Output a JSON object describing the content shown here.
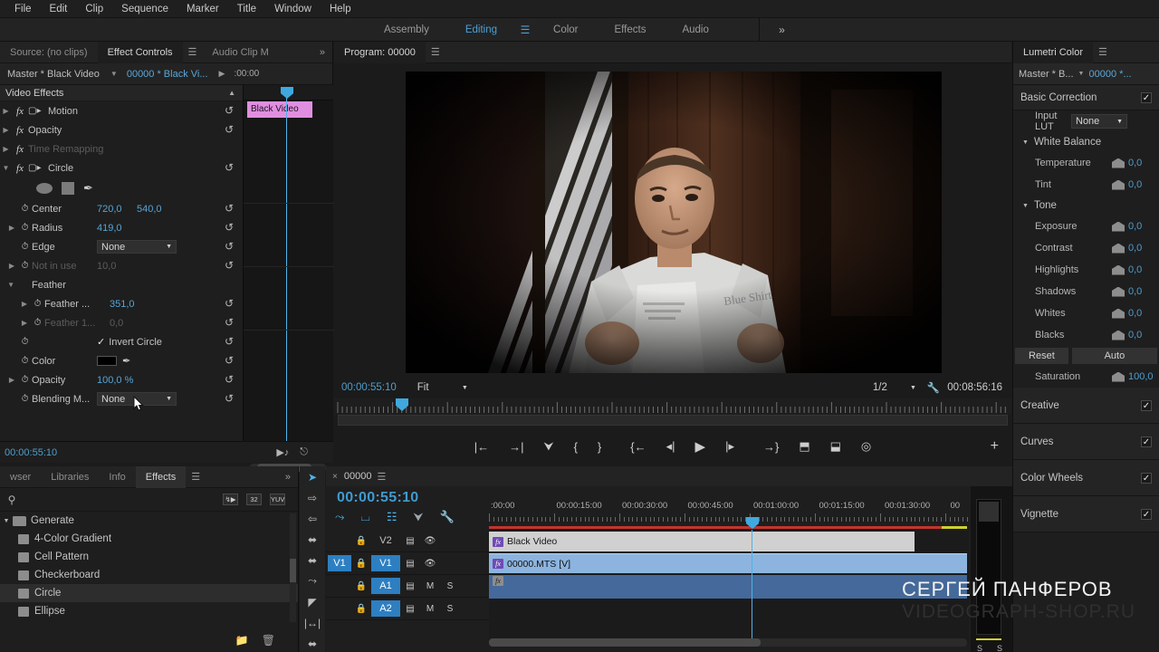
{
  "menu": {
    "items": [
      "File",
      "Edit",
      "Clip",
      "Sequence",
      "Marker",
      "Title",
      "Window",
      "Help"
    ]
  },
  "workspace": {
    "tabs": [
      "Assembly",
      "Editing",
      "Color",
      "Effects",
      "Audio"
    ],
    "active": "Editing",
    "menu_icon": "☰",
    "overflow_icon": "»"
  },
  "effect_controls": {
    "tabs": [
      {
        "label": "Source: (no clips)",
        "active": false
      },
      {
        "label": "Effect Controls",
        "active": true
      },
      {
        "label": "Audio Clip M",
        "active": false
      }
    ],
    "tab_menu_icon": "☰",
    "overflow_icon": "»",
    "master_label": "Master * Black Video",
    "dropdown_icon": "▼",
    "clip_label": "00000 * Black Vi...",
    "play_icon": "▶",
    "timeline_start": ":00:00",
    "timeline_clip_label": "Black Video",
    "section_title": "Video Effects",
    "collapse_icon": "▲",
    "reset_icon": "↺",
    "effects": [
      {
        "name": "Motion",
        "twirl": "▶",
        "fx": "fx",
        "has_transform": true,
        "dim": false
      },
      {
        "name": "Opacity",
        "twirl": "▶",
        "fx": "fx",
        "has_transform": false,
        "dim": false
      },
      {
        "name": "Time Remapping",
        "twirl": "▶",
        "fx": "fx",
        "has_transform": false,
        "dim": true
      },
      {
        "name": "Circle",
        "twirl": "▼",
        "fx": "fx",
        "has_transform": true,
        "dim": false
      }
    ],
    "circle_params": {
      "shape_tools": [
        "ellipse-mask",
        "rectangle-mask",
        "pen-mask"
      ],
      "rows": [
        {
          "name": "Center",
          "value": "720,0",
          "value2": "540,0",
          "type": "two",
          "twirl": "",
          "dim": false
        },
        {
          "name": "Radius",
          "value": "419,0",
          "type": "one",
          "twirl": "▶",
          "dim": false
        },
        {
          "name": "Edge",
          "value": "None",
          "type": "dropdown",
          "twirl": "",
          "dim": false
        },
        {
          "name": "Not in use",
          "value": "10,0",
          "type": "one",
          "twirl": "▶",
          "dim": true
        },
        {
          "name": "Feather",
          "value": "",
          "type": "group",
          "twirl": "▼",
          "dim": false
        },
        {
          "name": "Feather ...",
          "value": "351,0",
          "type": "one",
          "twirl": "▶",
          "dim": false,
          "indent": true
        },
        {
          "name": "Feather 1...",
          "value": "0,0",
          "type": "one",
          "twirl": "▶",
          "dim": true,
          "indent": true
        },
        {
          "name": "",
          "value": "Invert Circle",
          "type": "checkbox",
          "twirl": "",
          "dim": false
        },
        {
          "name": "Color",
          "value": "#000000",
          "type": "color",
          "twirl": "",
          "dim": false
        },
        {
          "name": "Opacity",
          "value": "100,0 %",
          "type": "one",
          "twirl": "▶",
          "dim": false
        },
        {
          "name": "Blending M...",
          "value": "None",
          "type": "dropdown",
          "twirl": "",
          "dim": false
        }
      ]
    },
    "status_timecode": "00:00:55:10",
    "status_icons": [
      "play-audio-icon",
      "export-frame-icon"
    ]
  },
  "program_monitor": {
    "tab_label": "Program: 00000",
    "tab_menu_icon": "☰",
    "timecode": "00:00:55:10",
    "fit_label": "Fit",
    "resolution_label": "1/2",
    "wrench_icon": "⚒",
    "duration": "00:08:56:16",
    "buttons": [
      "mark-in",
      "mark-out",
      "add-marker",
      "go-to-in",
      "go-to-out",
      "step-back-unit",
      "step-back",
      "play-pause",
      "step-forward",
      "step-forward-unit",
      "lift",
      "extract",
      "export-frame"
    ],
    "button_glyphs": [
      "|←",
      "→|",
      "⮟",
      "{",
      "}",
      "{←",
      "◂|",
      "▶",
      "|▸",
      "→}",
      "⬒",
      "⬓",
      "◎"
    ],
    "plus_icon": "+"
  },
  "lumetri": {
    "tab_label": "Lumetri Color",
    "tab_menu_icon": "☰",
    "master_label": "Master * B...",
    "dropdown_icon": "▼",
    "clip_label": "00000 *...",
    "check_icon": "✓",
    "sections": [
      {
        "label": "Basic Correction",
        "checked": true
      },
      {
        "label": "Creative",
        "checked": true
      },
      {
        "label": "Curves",
        "checked": true
      },
      {
        "label": "Color Wheels",
        "checked": true
      },
      {
        "label": "Vignette",
        "checked": true
      }
    ],
    "input_lut_label": "Input LUT",
    "input_lut_value": "None",
    "white_balance_label": "White Balance",
    "tone_label": "Tone",
    "group_twirl": "▼",
    "sliders": [
      {
        "label": "Temperature",
        "value": "0,0"
      },
      {
        "label": "Tint",
        "value": "0,0"
      },
      {
        "label": "Exposure",
        "value": "0,0"
      },
      {
        "label": "Contrast",
        "value": "0,0"
      },
      {
        "label": "Highlights",
        "value": "0,0"
      },
      {
        "label": "Shadows",
        "value": "0,0"
      },
      {
        "label": "Whites",
        "value": "0,0"
      },
      {
        "label": "Blacks",
        "value": "0,0"
      }
    ],
    "reset_label": "Reset",
    "auto_label": "Auto",
    "saturation_label": "Saturation",
    "saturation_value": "100,0"
  },
  "effects_browser": {
    "tabs": [
      {
        "label": "wser",
        "active": false
      },
      {
        "label": "Libraries",
        "active": false
      },
      {
        "label": "Info",
        "active": false
      },
      {
        "label": "Effects",
        "active": true
      }
    ],
    "tab_menu_icon": "☰",
    "overflow_icon": "»",
    "search_placeholder": "",
    "search_value": "",
    "filter_icons": [
      "accelerated-effects-icon",
      "32-bit-color-icon",
      "yuv-icon"
    ],
    "filter_labels": [
      "↯▶",
      "32",
      "YUV"
    ],
    "folder": {
      "label": "Generate",
      "twirl": "▼"
    },
    "items": [
      {
        "label": "4-Color Gradient",
        "selected": false
      },
      {
        "label": "Cell Pattern",
        "selected": false
      },
      {
        "label": "Checkerboard",
        "selected": false
      },
      {
        "label": "Circle",
        "selected": true
      },
      {
        "label": "Ellipse",
        "selected": false
      }
    ],
    "footer_icons": [
      "new-folder-icon",
      "delete-icon"
    ]
  },
  "tools": {
    "items": [
      {
        "name": "selection-tool",
        "glyph": "➤",
        "active": true
      },
      {
        "name": "track-select-fwd-tool",
        "glyph": "⇨",
        "active": false
      },
      {
        "name": "track-select-back-tool",
        "glyph": "⇦",
        "active": false
      },
      {
        "name": "ripple-edit-tool",
        "glyph": "⬌",
        "active": false
      },
      {
        "name": "rolling-edit-tool",
        "glyph": "⬌",
        "active": false
      },
      {
        "name": "rate-stretch-tool",
        "glyph": "⤳",
        "active": false
      },
      {
        "name": "razor-tool",
        "glyph": "◤",
        "active": false
      },
      {
        "name": "slip-tool",
        "glyph": "|↔|",
        "active": false
      },
      {
        "name": "slide-tool",
        "glyph": "⬌",
        "active": false
      }
    ]
  },
  "timeline": {
    "tab_label": "00000",
    "close_icon": "×",
    "tab_menu_icon": "☰",
    "timecode": "00:00:55:10",
    "toolbar_icons": [
      "snap-icon",
      "linked-selection-icon",
      "markers-visible-icon",
      "add-marker-icon",
      "timeline-settings-icon"
    ],
    "ruler_labels": [
      ":00:00",
      "00:00:15:00",
      "00:00:30:00",
      "00:00:45:00",
      "00:01:00:00",
      "00:01:15:00",
      "00:01:30:00",
      "00"
    ],
    "tracks": [
      {
        "name": "V2",
        "source": "",
        "lock": "🔒",
        "sync": "☷",
        "eye": "◉",
        "mute": "",
        "solo": "",
        "active": false
      },
      {
        "name": "V1",
        "source": "V1",
        "lock": "🔒",
        "sync": "☷",
        "eye": "◉",
        "mute": "",
        "solo": "",
        "active": true
      },
      {
        "name": "A1",
        "source": "",
        "lock": "🔒",
        "sync": "☷",
        "eye": "",
        "mute": "M",
        "solo": "S",
        "active": true
      },
      {
        "name": "A2",
        "source": "",
        "lock": "🔒",
        "sync": "☷",
        "eye": "",
        "mute": "M",
        "solo": "S",
        "active": true
      }
    ],
    "clips": [
      {
        "track": "V2",
        "label": "Black Video",
        "fx": "fx"
      },
      {
        "track": "V1",
        "label": "00000.MTS [V]",
        "fx": "fx"
      },
      {
        "track": "A1",
        "label": "",
        "fx": "fx"
      }
    ],
    "solo_labels": [
      "S",
      "S"
    ]
  },
  "watermark": {
    "line1": "СЕРГЕЙ ПАНФЕРОВ",
    "line2": "VIDEOGRAPH-SHOP.RU"
  },
  "colors": {
    "accent_blue": "#4e9ecd",
    "panel_bg": "#1e1e1e",
    "tab_bg": "#232323",
    "clip_blue": "#8cb4de",
    "clip_grey": "#d0d0d0",
    "pink_clip": "#e08fe0",
    "red_render_bar": "#c4352b",
    "yellow_render_bar": "#cfd02f"
  }
}
